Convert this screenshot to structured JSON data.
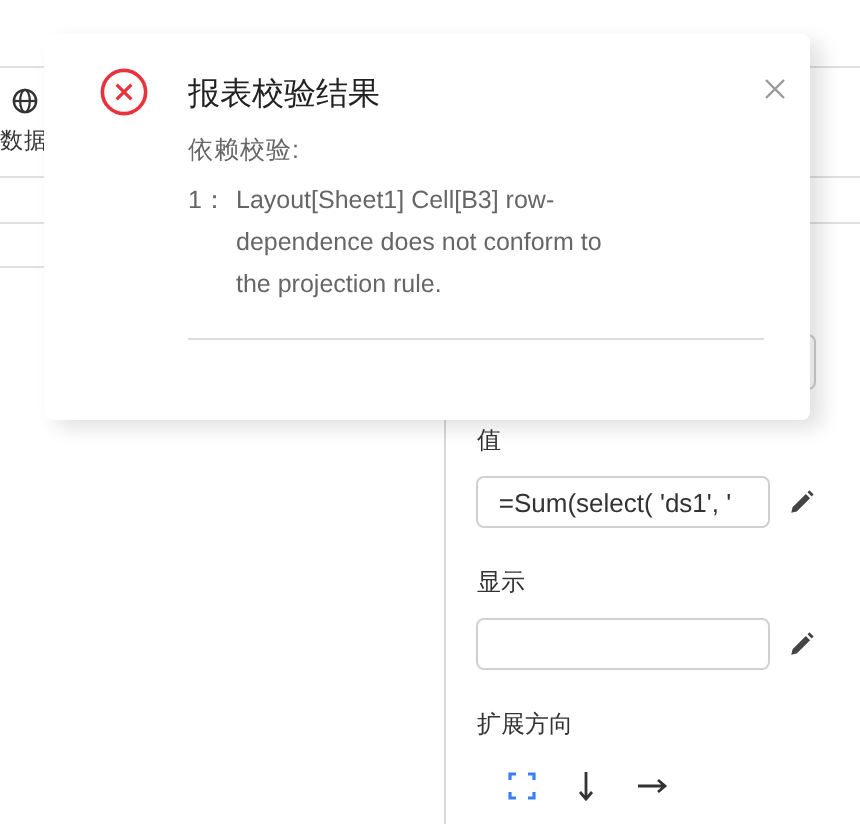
{
  "toolbar": {
    "label": "数据"
  },
  "panel": {
    "fields": [
      {
        "label": "值",
        "value": "=Sum(select( 'ds1', '"
      },
      {
        "label": "显示"
      }
    ],
    "expand": {
      "label": "扩展方向",
      "options": [
        {
          "kind": "both",
          "selected": true
        },
        {
          "kind": "down",
          "selected": false
        },
        {
          "kind": "right",
          "selected": false
        }
      ]
    }
  },
  "dialog": {
    "title": "报表校验结果",
    "section": "依赖校验:",
    "items": [
      {
        "index": "1：",
        "text": "Layout[Sheet1] Cell[B3] row-dependence does not conform to the projection rule."
      }
    ]
  }
}
